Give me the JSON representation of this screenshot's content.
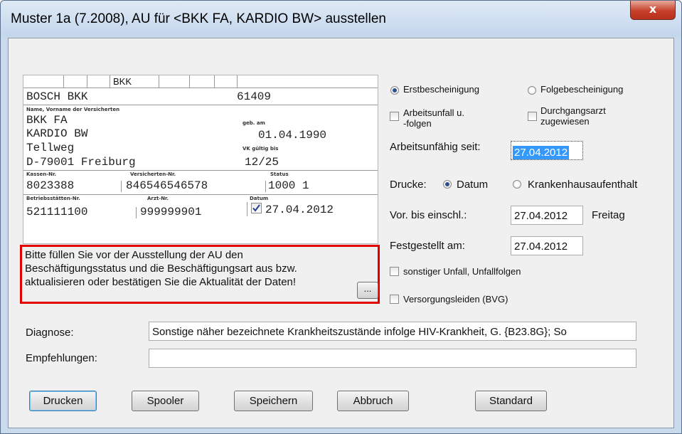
{
  "window": {
    "title": "Muster 1a (7.2008), AU für <BKK FA, KARDIO BW> ausstellen",
    "close_glyph": "x"
  },
  "card": {
    "header_cells": [
      "",
      "",
      "BKK",
      "",
      "",
      "",
      ""
    ],
    "kasse_name": "BOSCH BKK",
    "kasse_code": "61409",
    "name_label": "Name, Vorname der Versicherten",
    "name_last": "BKK FA",
    "name_first": "KARDIO BW",
    "geb_label": "geb. am",
    "geb_value": "01.04.1990",
    "street": "Tellweg",
    "city": "D-79001 Freiburg",
    "vk_label": "VK gültig bis",
    "vk_value": "12/25",
    "kassen_nr_label": "Kassen-Nr.",
    "kassen_nr": "8023388",
    "versicherten_nr_label": "Versicherten-Nr.",
    "versicherten_nr": "846546546578",
    "status_label": "Status",
    "status": "1000 1",
    "betriebsstaetten_label": "Betriebsstätten-Nr.",
    "betriebsstaetten_nr": "521111100",
    "arzt_label": "Arzt-Nr.",
    "arzt_nr": "999999901",
    "datum_label": "Datum",
    "datum": "27.04.2012",
    "datum_checked": true
  },
  "notice": {
    "line1": "Bitte füllen Sie vor der Ausstellung der AU den",
    "line2": "Beschäftigungsstatus und die Beschäftigungsart aus bzw.",
    "line3": "aktualisieren oder bestätigen Sie die Aktualität der Daten!",
    "button_label": "..."
  },
  "right": {
    "erst_label": "Erstbescheinigung",
    "folge_label": "Folgebescheinigung",
    "erst_selected": true,
    "arbeitsunfall_line1": "Arbeitsunfall u.",
    "arbeitsunfall_line2": "-folgen",
    "durchgangsarzt_line1": "Durchgangsarzt",
    "durchgangsarzt_line2": "zugewiesen",
    "au_seit_label": "Arbeitsunfähig seit:",
    "au_seit_value": "27.04.2012",
    "drucke_label": "Drucke:",
    "drucke_datum": "Datum",
    "drucke_kh": "Krankenhausaufenthalt",
    "drucke_selected": "Datum",
    "vor_bis_label": "Vor. bis einschl.:",
    "vor_bis_value": "27.04.2012",
    "vor_bis_day": "Freitag",
    "festgestellt_label": "Festgestellt am:",
    "festgestellt_value": "27.04.2012",
    "sonstiger_unfall": "sonstiger Unfall, Unfallfolgen",
    "versorgungsleiden": "Versorgungsleiden (BVG)"
  },
  "form": {
    "diagnose_label": "Diagnose:",
    "diagnose_value": "Sonstige näher bezeichnete Krankheitszustände infolge HIV-Krankheit, G. {B23.8G}; So",
    "empfehlungen_label": "Empfehlungen:",
    "empfehlungen_value": ""
  },
  "buttons": {
    "drucken": "Drucken",
    "spooler": "Spooler",
    "speichern": "Speichern",
    "abbruch": "Abbruch",
    "standard": "Standard"
  },
  "colors": {
    "highlight_border": "#e00000",
    "selection_bg": "#3399ff",
    "close_button": "#c7402b"
  }
}
